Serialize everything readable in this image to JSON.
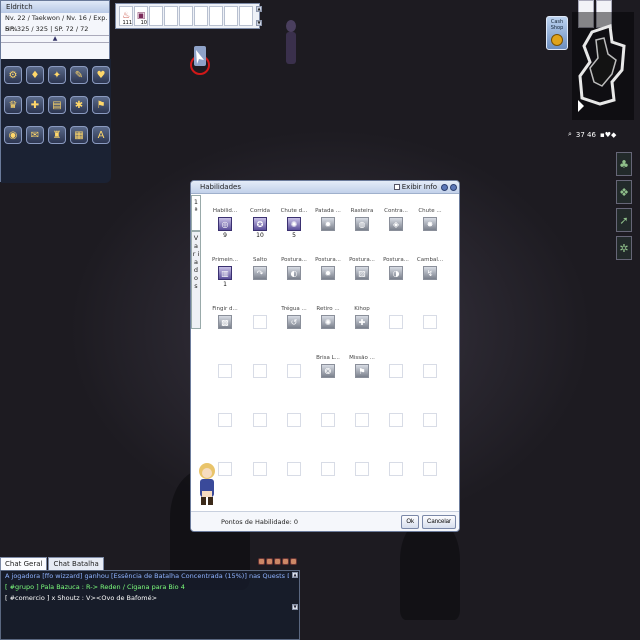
{
  "basic_info": {
    "character_name": "Eldritch",
    "level_line": "Nv. 22 / Taekwon / Nv. 16 / Exp. 5 %",
    "hp_sp_line": "HP. 325 / 325 | SP. 72 / 72",
    "expand_arrow": "▲"
  },
  "menu_icons": [
    {
      "icon": "equipment-icon",
      "glyph": "⚙"
    },
    {
      "icon": "items-icon",
      "glyph": "♦"
    },
    {
      "icon": "skills-icon",
      "glyph": "✦"
    },
    {
      "icon": "quest-icon",
      "glyph": "✎"
    },
    {
      "icon": "party-icon",
      "glyph": "♥"
    },
    {
      "icon": "guild-icon",
      "glyph": "♛"
    },
    {
      "icon": "friends-icon",
      "glyph": "✚"
    },
    {
      "icon": "map-icon",
      "glyph": "▤"
    },
    {
      "icon": "options-icon",
      "glyph": "✱"
    },
    {
      "icon": "storage-icon",
      "glyph": "⚑"
    },
    {
      "icon": "camera-icon",
      "glyph": "◉"
    },
    {
      "icon": "mail-icon",
      "glyph": "✉"
    },
    {
      "icon": "ranking-icon",
      "glyph": "♜"
    },
    {
      "icon": "keyboard-icon",
      "glyph": "▦"
    },
    {
      "icon": "help-icon",
      "glyph": "A"
    }
  ],
  "hotkey_bar": {
    "slots": [
      {
        "glyph": "♨",
        "count": "111"
      },
      {
        "glyph": "▣",
        "count": "10"
      },
      {
        "glyph": "",
        "count": ""
      },
      {
        "glyph": "",
        "count": ""
      },
      {
        "glyph": "",
        "count": ""
      },
      {
        "glyph": "",
        "count": ""
      },
      {
        "glyph": "",
        "count": ""
      },
      {
        "glyph": "",
        "count": ""
      },
      {
        "glyph": "",
        "count": ""
      }
    ],
    "scroll_up": "▲",
    "scroll_down": "▼"
  },
  "cash_shop": {
    "label": "Cash Shop"
  },
  "minimap": {
    "coords": "37 46",
    "zoom_icon": "🔍"
  },
  "status_icons": [
    {
      "icon": "tree-buff-icon",
      "glyph": "♣"
    },
    {
      "icon": "wing-buff-icon",
      "glyph": "❖"
    },
    {
      "icon": "arrow-buff-icon",
      "glyph": "➚"
    },
    {
      "icon": "gear-buff-icon",
      "glyph": "✲"
    }
  ],
  "skill_window": {
    "title": "Habilidades",
    "show_info_label": "Exibir Info",
    "tabs": [
      "1 ª",
      "V a r i a d o s"
    ],
    "skills": [
      {
        "name": "Habilid...",
        "glyph": "◎",
        "level": "9",
        "state": "learned"
      },
      {
        "name": "Corrida",
        "glyph": "✪",
        "level": "10",
        "state": "learned"
      },
      {
        "name": "Chute d...",
        "glyph": "✺",
        "level": "5",
        "state": "learned"
      },
      {
        "name": "Patada ...",
        "glyph": "✹",
        "level": "",
        "state": "locked"
      },
      {
        "name": "Rasteira",
        "glyph": "◍",
        "level": "",
        "state": "locked"
      },
      {
        "name": "Contra...",
        "glyph": "◈",
        "level": "",
        "state": "locked"
      },
      {
        "name": "Chute ...",
        "glyph": "✸",
        "level": "",
        "state": "locked"
      },
      {
        "name": "Primein...",
        "glyph": "▥",
        "level": "1",
        "state": "learned"
      },
      {
        "name": "Salto",
        "glyph": "↷",
        "level": "",
        "state": "locked"
      },
      {
        "name": "Postura...",
        "glyph": "◐",
        "level": "",
        "state": "locked"
      },
      {
        "name": "Postura...",
        "glyph": "✹",
        "level": "",
        "state": "locked"
      },
      {
        "name": "Postura...",
        "glyph": "▨",
        "level": "",
        "state": "locked"
      },
      {
        "name": "Postura...",
        "glyph": "◑",
        "level": "",
        "state": "locked"
      },
      {
        "name": "Cambal...",
        "glyph": "↯",
        "level": "",
        "state": "locked"
      },
      {
        "name": "Fingir d...",
        "glyph": "▩",
        "level": "",
        "state": "locked"
      },
      {
        "name": "",
        "glyph": "",
        "level": "",
        "state": "empty"
      },
      {
        "name": "Trégua ...",
        "glyph": "↺",
        "level": "",
        "state": "locked"
      },
      {
        "name": "Retiro ...",
        "glyph": "✺",
        "level": "",
        "state": "locked"
      },
      {
        "name": "Kihop",
        "glyph": "✚",
        "level": "",
        "state": "locked"
      },
      {
        "name": "",
        "glyph": "",
        "level": "",
        "state": "empty"
      },
      {
        "name": "",
        "glyph": "",
        "level": "",
        "state": "empty"
      },
      {
        "name": "",
        "glyph": "",
        "level": "",
        "state": "empty"
      },
      {
        "name": "",
        "glyph": "",
        "level": "",
        "state": "empty"
      },
      {
        "name": "",
        "glyph": "",
        "level": "",
        "state": "empty"
      },
      {
        "name": "Brisa L...",
        "glyph": "❂",
        "level": "",
        "state": "locked"
      },
      {
        "name": "Missão ...",
        "glyph": "⚑",
        "level": "",
        "state": "locked"
      },
      {
        "name": "",
        "glyph": "",
        "level": "",
        "state": "empty"
      },
      {
        "name": "",
        "glyph": "",
        "level": "",
        "state": "empty"
      },
      {
        "name": "",
        "glyph": "",
        "level": "",
        "state": "empty"
      },
      {
        "name": "",
        "glyph": "",
        "level": "",
        "state": "empty"
      },
      {
        "name": "",
        "glyph": "",
        "level": "",
        "state": "empty"
      },
      {
        "name": "",
        "glyph": "",
        "level": "",
        "state": "empty"
      },
      {
        "name": "",
        "glyph": "",
        "level": "",
        "state": "empty"
      },
      {
        "name": "",
        "glyph": "",
        "level": "",
        "state": "empty"
      },
      {
        "name": "",
        "glyph": "",
        "level": "",
        "state": "empty"
      },
      {
        "name": "",
        "glyph": "",
        "level": "",
        "state": "empty"
      },
      {
        "name": "",
        "glyph": "",
        "level": "",
        "state": "empty"
      },
      {
        "name": "",
        "glyph": "",
        "level": "",
        "state": "empty"
      },
      {
        "name": "",
        "glyph": "",
        "level": "",
        "state": "empty"
      },
      {
        "name": "",
        "glyph": "",
        "level": "",
        "state": "empty"
      },
      {
        "name": "",
        "glyph": "",
        "level": "",
        "state": "empty"
      },
      {
        "name": "",
        "glyph": "",
        "level": "",
        "state": "empty"
      }
    ],
    "skill_points": "Pontos de Habilidade: 0",
    "ok_label": "Ok",
    "cancel_label": "Cancelar"
  },
  "chat": {
    "tabs": [
      "Chat Geral",
      "Chat Batalha"
    ],
    "lines": [
      {
        "text": "A jogadora [ffo wizzard] ganhou [Essência de Batalha Concentrada (15%)] nas Quests Diárias.",
        "color": "#8fb3ff"
      },
      {
        "text": "[ #grupo ] Pala Bazuca : R-> Reden / Cigana para Bio 4",
        "color": "#7dff7d"
      },
      {
        "text": "[ #comercio ] x Shoutz : V><Ovo de Bafomé>",
        "color": "#ffffff"
      }
    ],
    "scroll_up": "▲",
    "scroll_down": "▼"
  },
  "colors": {
    "learned": "#5b4f9a",
    "window_border": "#6c7c9c",
    "background": "#2a2730"
  }
}
